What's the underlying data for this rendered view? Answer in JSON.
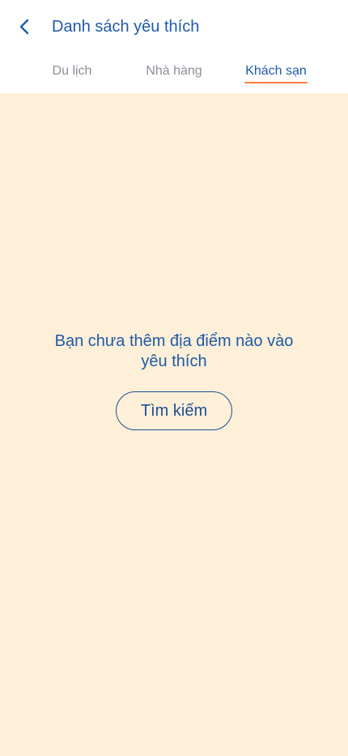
{
  "header": {
    "title": "Danh sách yêu thích",
    "back_icon": "chevron-left-icon"
  },
  "tabs": [
    {
      "label": "Du lịch",
      "selected": false
    },
    {
      "label": "Nhà hàng",
      "selected": false
    },
    {
      "label": "Khách sạn",
      "selected": true
    }
  ],
  "empty_state": {
    "message": "Bạn chưa thêm địa điểm nào vào yêu thích",
    "button_label": "Tìm kiếm"
  },
  "colors": {
    "primary": "#1f5aa8",
    "tab_inactive": "#8b8f99",
    "tab_indicator": "#ff7a3d",
    "content_background": "#fdefd8"
  }
}
